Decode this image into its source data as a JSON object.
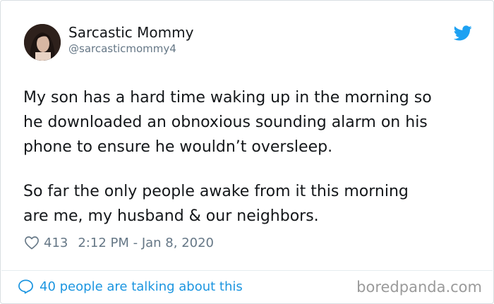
{
  "author": {
    "display_name": "Sarcastic Mommy",
    "handle": "@sarcasticmommy4",
    "avatar_icon": "profile-photo"
  },
  "platform_icon": "twitter-bird-icon",
  "tweet": {
    "paragraph_1": "My son has a hard time waking up in the morning so\nhe downloaded an obnoxious sounding alarm on his\nphone to ensure he wouldn’t oversleep.",
    "paragraph_2": "So far the only people awake from it this morning\nare me, my husband & our neighbors."
  },
  "meta": {
    "like_count": "413",
    "timestamp": "2:12 PM - Jan 8, 2020"
  },
  "footer": {
    "talking_label": "40 people are talking about this",
    "watermark": "boredpanda.com"
  },
  "colors": {
    "accent": "#1b95e0",
    "muted": "#657786",
    "text": "#14171a"
  }
}
